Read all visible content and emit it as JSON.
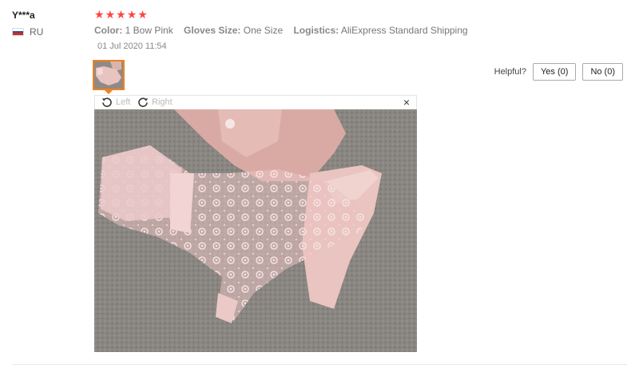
{
  "review": {
    "user_name": "Y***a",
    "country_code": "RU",
    "rating": 5,
    "stars": [
      "★",
      "★",
      "★",
      "★",
      "★"
    ],
    "attributes": [
      {
        "key": "Color:",
        "value": "1 Bow Pink"
      },
      {
        "key": "Gloves Size:",
        "value": "One Size"
      },
      {
        "key": "Logistics:",
        "value": "AliExpress Standard Shipping"
      }
    ],
    "date": "01 Jul 2020 11:54"
  },
  "helpful": {
    "label": "Helpful?",
    "yes_label": "Yes (0)",
    "no_label": "No (0)"
  },
  "viewer": {
    "rotate_left_label": "Left",
    "rotate_right_label": "Right",
    "close_symbol": "×"
  },
  "icons": {
    "flag": "russia-flag-icon",
    "star": "star-icon",
    "rotate_left": "rotate-left-icon",
    "rotate_right": "rotate-right-icon",
    "close": "close-icon"
  },
  "colors": {
    "star": "#ff4444",
    "thumb_border": "#f0821e"
  }
}
